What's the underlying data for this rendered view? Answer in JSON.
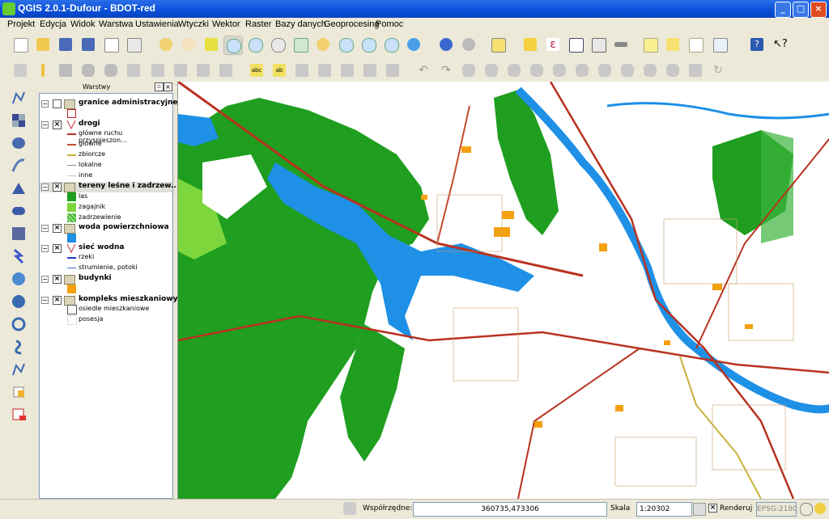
{
  "window": {
    "title": "QGIS 2.0.1-Dufour - BDOT-red",
    "min": "_",
    "max": "□",
    "close": "×"
  },
  "menu": [
    "Projekt",
    "Edycja",
    "Widok",
    "Warstwa",
    "Ustawienia",
    "Wtyczki",
    "Wektor",
    "Raster",
    "Bazy danych",
    "Geoprocesing",
    "Pomoc"
  ],
  "toolbar_icons": {
    "row1": [
      "new-project-icon",
      "open-project-icon",
      "save-project-icon",
      "save-as-icon",
      "new-print-composer-icon",
      "composer-manager-icon",
      "pan-map-icon",
      "pan-to-selection-icon",
      "zoom-in-icon",
      "zoom-out-icon",
      "zoom-actual-size-icon",
      "zoom-full-icon",
      "zoom-to-selection-icon",
      "zoom-to-layer-icon",
      "zoom-last-icon",
      "zoom-next-icon",
      "refresh-icon",
      "identify-icon",
      "actions-icon",
      "select-features-icon",
      "deselect-icon",
      "field-calculator-icon",
      "attribute-table-icon",
      "statistics-icon",
      "measure-icon",
      "map-tips-icon",
      "new-bookmark-icon",
      "show-bookmarks-icon",
      "text-annotation-icon",
      "help-icon",
      "whats-this-icon"
    ],
    "row2": [
      "current-edits-icon",
      "toggle-editing-icon",
      "save-edits-icon",
      "add-feature-icon",
      "move-feature-icon",
      "node-tool-icon",
      "delete-selected-icon",
      "cut-features-icon",
      "copy-features-icon",
      "paste-features-icon",
      "label-icon",
      "pin-labels-icon",
      "show-hide-labels-icon",
      "move-label-icon",
      "rotate-label-icon",
      "change-label-icon",
      "undo-icon",
      "redo-icon",
      "simplify-icon",
      "add-ring-icon",
      "add-part-icon",
      "delete-ring-icon",
      "delete-part-icon",
      "reshape-icon",
      "offset-curve-icon",
      "split-features-icon",
      "split-parts-icon",
      "merge-features-icon",
      "merge-attributes-icon",
      "rotate-point-icon"
    ]
  },
  "left_tools": [
    "add-vector-layer-icon",
    "add-raster-layer-icon",
    "add-postgis-layer-icon",
    "add-spatialite-layer-icon",
    "add-mssql-layer-icon",
    "add-oracle-layer-icon",
    "add-wms-layer-icon",
    "add-wcs-layer-icon",
    "add-wfs-layer-icon",
    "add-delimited-text-icon",
    "new-shapefile-icon",
    "new-spatialite-icon",
    "remove-layer-icon",
    "new-gpx-icon"
  ],
  "layers_panel": {
    "title": "Warstwy",
    "groups": [
      {
        "name": "granice administracyjne",
        "checked": false,
        "symbol_color": "#ffffff",
        "items": []
      },
      {
        "name": "drogi",
        "checked": true,
        "items": [
          {
            "label": "główne ruchu przyspieszon...",
            "color": "#b83220"
          },
          {
            "label": "główne",
            "color": "#c44d2c"
          },
          {
            "label": "zbiorcze",
            "color": "#c8b33a"
          },
          {
            "label": "lokalne",
            "color": "#8c8c8c"
          },
          {
            "label": "inne",
            "color": "#c8c8c8"
          }
        ]
      },
      {
        "name": "tereny leśne i zadrzew...",
        "checked": true,
        "items": [
          {
            "label": "las",
            "color": "#1f9e1f"
          },
          {
            "label": "zagajnik",
            "color": "#7cd63c"
          },
          {
            "label": "zadrzewienie",
            "color": "#3cb43c"
          }
        ]
      },
      {
        "name": "woda powierzchniowa",
        "checked": true,
        "symbol_color": "#1e90e6",
        "items": []
      },
      {
        "name": "sieć wodna",
        "checked": true,
        "items": [
          {
            "label": "rzeki",
            "color": "#1a3cc8"
          },
          {
            "label": "strumienie, potoki",
            "color": "#4a6ad2"
          }
        ]
      },
      {
        "name": "budynki",
        "checked": true,
        "symbol_color": "#f5a010",
        "items": []
      },
      {
        "name": "kompleks mieszkaniowy",
        "checked": true,
        "items": [
          {
            "label": "osiedle mieszkaniowe",
            "color": "#ffffff"
          },
          {
            "label": "posesja",
            "color": "#ffffff"
          }
        ]
      }
    ]
  },
  "statusbar": {
    "coord_label": "Współrzędne:",
    "coord_value": "360735,473306",
    "scale_label": "Skala",
    "scale_value": "1:20302",
    "render_label": "Renderuj",
    "render_checked": true,
    "crs": "EPSG:2180"
  },
  "colors": {
    "forest": "#1f9e1f",
    "water": "#1e90e6",
    "road_main": "#b83220",
    "road_secondary": "#c8b33a",
    "building": "#f5a010"
  }
}
